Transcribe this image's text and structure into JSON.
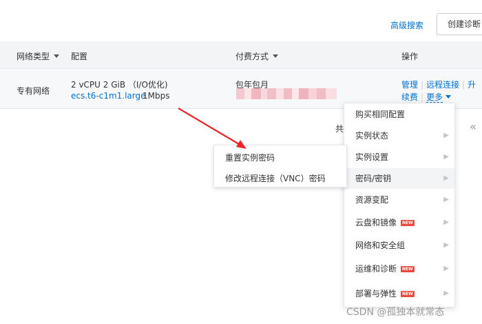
{
  "toolbar": {
    "advanced_search": "高级搜索",
    "create_diagnosis": "创建诊断"
  },
  "table": {
    "headers": {
      "network_type": "网络类型",
      "config": "配置",
      "billing": "付费方式",
      "actions": "操作"
    },
    "row": {
      "network_type": "专有网络",
      "config_spec": "2 vCPU 2 GiB （I/O优化)",
      "instance_type": "ecs.t6-c1m1.large",
      "bandwidth": "1Mbps",
      "billing": "包年包月",
      "actions": {
        "manage": "管理",
        "remote": "远程连接",
        "upgrade": "升",
        "renew": "续费",
        "more": "更多"
      }
    }
  },
  "pagination": {
    "total_prefix": "共",
    "first_page": "«"
  },
  "dropdown": {
    "items": [
      {
        "label": "购买相同配置"
      },
      {
        "label": "实例状态"
      },
      {
        "label": "实例设置"
      },
      {
        "label": "密码/密钥"
      },
      {
        "label": "资源变配"
      },
      {
        "label": "云盘和镜像",
        "badge": "NEW"
      },
      {
        "label": "网络和安全组"
      },
      {
        "label": "运维和诊断",
        "badge": "NEW"
      },
      {
        "label": "部署与弹性",
        "badge": "NEW"
      }
    ]
  },
  "submenu": {
    "items": [
      {
        "label": "重置实例密码"
      },
      {
        "label": "修改远程连接（VNC）密码"
      }
    ]
  },
  "colors": {
    "link": "#0070cc",
    "arrow": "#e8262a",
    "badge": "#e64a3c"
  },
  "watermark": "CSDN @孤独本就常态"
}
